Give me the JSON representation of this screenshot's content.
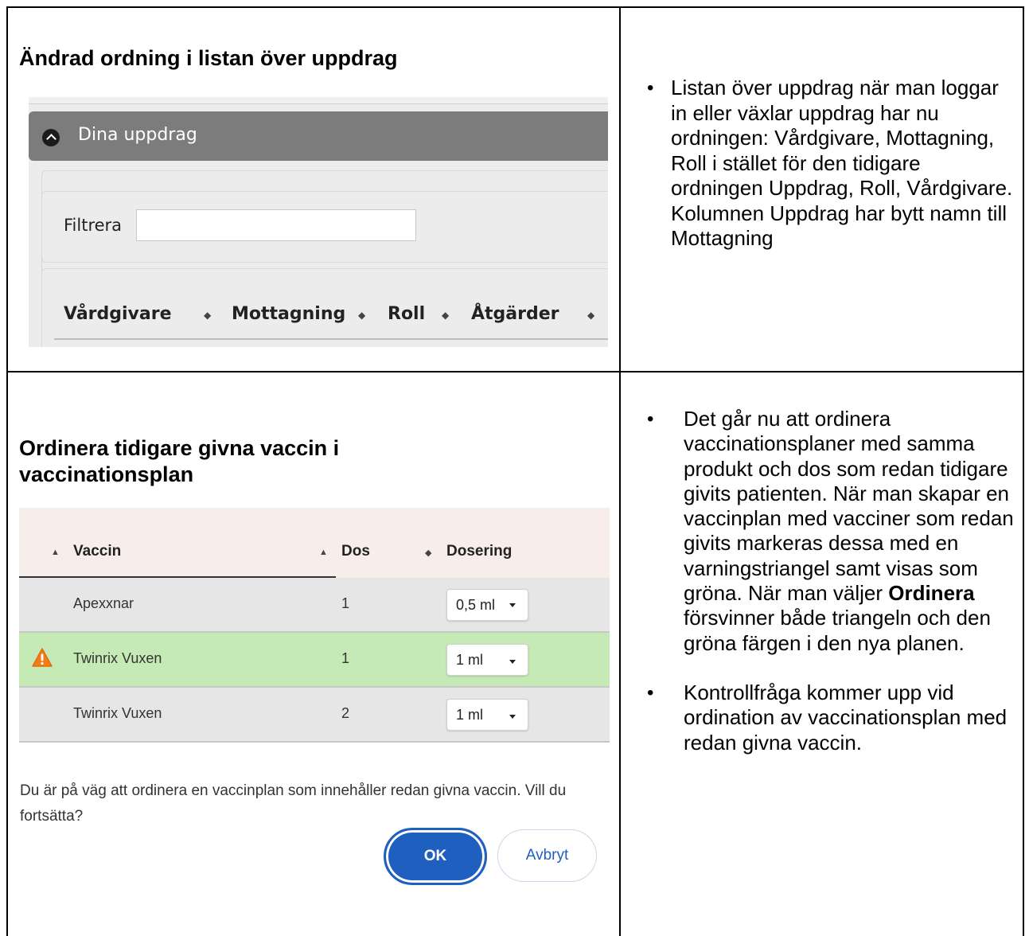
{
  "section1": {
    "title": "Ändrad ordning i listan över uppdrag",
    "bullets": [
      "Listan över uppdrag när man loggar in eller växlar uppdrag har nu ordningen: Vårdgivare, Mottagning, Roll i stället för den tidigare ordningen Uppdrag, Roll, Vårdgivare. Kolumnen Uppdrag har bytt namn till Mottagning"
    ],
    "screenshot": {
      "panel_title": "Dina uppdrag",
      "filter_label": "Filtrera",
      "filter_value": "",
      "columns": [
        "Vårdgivare",
        "Mottagning",
        "Roll",
        "Åtgärder"
      ]
    }
  },
  "section2": {
    "title": "Ordinera tidigare givna vaccin i vaccinationsplan",
    "bullets": [
      {
        "before": "Det går nu att ordinera vaccinationsplaner med samma produkt och dos som redan tidigare givits patienten. När man skapar en vaccinplan med vacciner som redan givits markeras dessa med en varningstriangel samt visas som gröna. När man väljer ",
        "bold": "Ordinera",
        "after": " försvinner både triangeln och den gröna färgen i den nya planen."
      },
      {
        "text": "Kontrollfråga kommer upp vid ordination av vaccinationsplan med redan givna vaccin."
      }
    ],
    "table": {
      "headers": [
        "Vaccin",
        "Dos",
        "Dosering"
      ],
      "rows": [
        {
          "vaccine": "Apexxnar",
          "dose": "1",
          "dosage": "0,5 ml",
          "warning": false,
          "color": "#e6e6e6"
        },
        {
          "vaccine": "Twinrix Vuxen",
          "dose": "1",
          "dosage": "1 ml",
          "warning": true,
          "color": "#c6eab5"
        },
        {
          "vaccine": "Twinrix Vuxen",
          "dose": "2",
          "dosage": "1 ml",
          "warning": false,
          "color": "#e6e6e6"
        }
      ]
    },
    "confirm_text": "Du är på väg att ordinera en vaccinplan som innehåller redan givna vaccin. Vill du fortsätta?",
    "ok_label": "OK",
    "cancel_label": "Avbryt"
  },
  "colors": {
    "primary_blue": "#1e5fbf",
    "header_gray": "#7c7c7c",
    "row_green": "#c6eab5",
    "row_gray": "#e6e6e6",
    "warning_orange": "#f07d1a"
  }
}
